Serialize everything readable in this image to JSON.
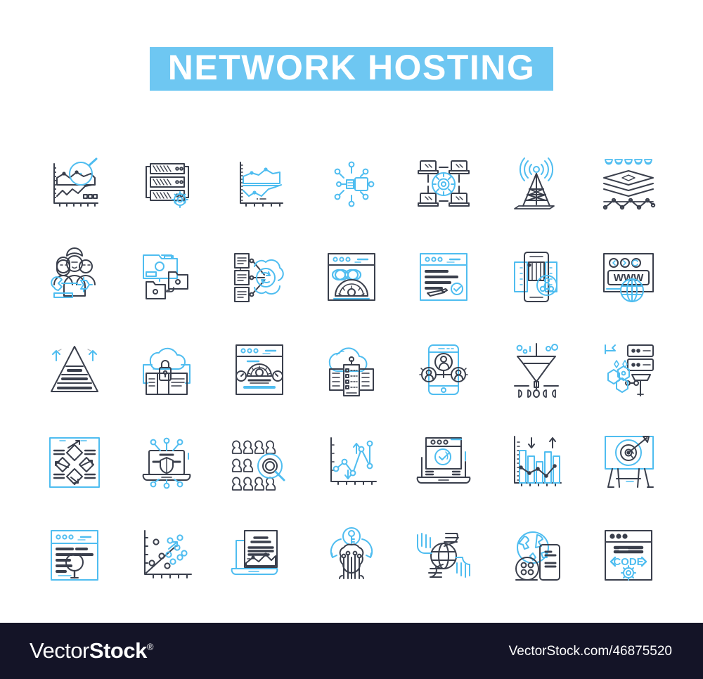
{
  "page": {
    "background": "#ffffff",
    "accent_blue": "#4fbdf0",
    "line_dark": "#3a3f4c",
    "footer_bg": "#141427"
  },
  "title": {
    "text": "NETWORK HOSTING",
    "banner_color": "#6ec7f2",
    "text_color": "#ffffff"
  },
  "icon_grid": {
    "columns": 7,
    "rows": 5,
    "icons": [
      {
        "name": "chart-magnifier-icon",
        "label": "Analytics search chart"
      },
      {
        "name": "server-rack-gear-icon",
        "label": "Server configuration"
      },
      {
        "name": "area-chart-icon",
        "label": "Bandwidth area chart"
      },
      {
        "name": "network-hub-nodes-icon",
        "label": "Network hub"
      },
      {
        "name": "laptops-gear-network-icon",
        "label": "Connected workstations"
      },
      {
        "name": "antenna-tower-signal-icon",
        "label": "Broadcast tower"
      },
      {
        "name": "layered-stack-icon",
        "label": "Stacked layers"
      },
      {
        "name": "team-wrench-gear-icon",
        "label": "Support team"
      },
      {
        "name": "folder-sync-icon",
        "label": "File folders"
      },
      {
        "name": "documents-cloud-sync-icon",
        "label": "Cloud sync documents"
      },
      {
        "name": "browser-infinity-gauge-icon",
        "label": "Unlimited bandwidth"
      },
      {
        "name": "browser-form-check-icon",
        "label": "Form validation"
      },
      {
        "name": "server-tower-share-icon",
        "label": "Server sharing"
      },
      {
        "name": "browser-www-globe-icon",
        "label": "WWW domain",
        "text": "WWW"
      },
      {
        "name": "pyramid-growth-icon",
        "label": "Tier pyramid"
      },
      {
        "name": "cloud-lock-document-icon",
        "label": "Secure cloud storage"
      },
      {
        "name": "browser-speedometer-icon",
        "label": "Speed test"
      },
      {
        "name": "datacenter-cloud-icon",
        "label": "Data center"
      },
      {
        "name": "phone-users-group-icon",
        "label": "Mobile users"
      },
      {
        "name": "funnel-data-filter-icon",
        "label": "Data funnel"
      },
      {
        "name": "server-hexagon-hammer-icon",
        "label": "Server build"
      },
      {
        "name": "diagram-diamonds-icon",
        "label": "Workflow diagram"
      },
      {
        "name": "laptop-shield-circuit-icon",
        "label": "Endpoint security"
      },
      {
        "name": "crowd-magnifier-icon",
        "label": "User search"
      },
      {
        "name": "line-chart-arrows-icon",
        "label": "Traffic trend"
      },
      {
        "name": "laptop-check-badge-icon",
        "label": "Verified uptime"
      },
      {
        "name": "bar-chart-arrows-icon",
        "label": "Performance bars"
      },
      {
        "name": "target-easel-dart-icon",
        "label": "Target goal"
      },
      {
        "name": "browser-text-magnifier-icon",
        "label": "Log inspection"
      },
      {
        "name": "scatter-plot-trend-icon",
        "label": "Scatter analysis"
      },
      {
        "name": "document-chart-laptop-icon",
        "label": "Report"
      },
      {
        "name": "brain-circuit-key-icon",
        "label": "AI access key"
      },
      {
        "name": "hands-globe-icon",
        "label": "Global support"
      },
      {
        "name": "globe-phone-icon",
        "label": "Mobile worldwide"
      },
      {
        "name": "browser-code-gear-icon",
        "label": "Code development",
        "text": "CODE"
      }
    ]
  },
  "footer": {
    "logo_light": "Vector",
    "logo_bold": "Stock",
    "logo_mark": "®",
    "url": "VectorStock.com/46875520"
  }
}
